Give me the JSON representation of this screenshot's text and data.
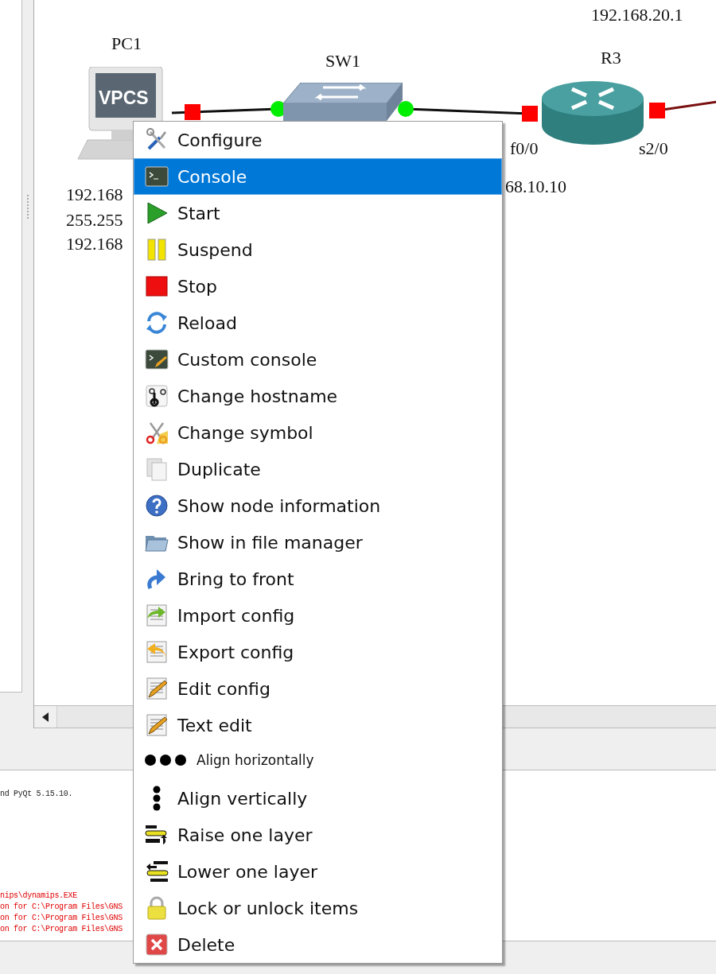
{
  "canvas": {
    "nodes": [
      {
        "kind": "pc",
        "name": "PC1",
        "screen_label": "VPCS"
      },
      {
        "kind": "switch",
        "name": "SW1"
      },
      {
        "kind": "router",
        "name": "R3"
      }
    ],
    "ports": [
      {
        "color": "#ff0000"
      },
      {
        "color": "#00ee00"
      },
      {
        "color": "#00ee00"
      },
      {
        "color": "#ff0000"
      },
      {
        "color": "#ff0000"
      }
    ],
    "labels": [
      {
        "text": "192.168.20.1"
      },
      {
        "text": "192.168"
      },
      {
        "text": "255.255"
      },
      {
        "text": "192.168"
      },
      {
        "text": "68.10.10"
      },
      {
        "text": "f0/0"
      },
      {
        "text": "s2/0"
      }
    ]
  },
  "console": {
    "lines": [
      {
        "text": "nd PyQt 5.15.10.",
        "kind": "info"
      },
      {
        "text": "nips\\dynamips.EXE",
        "kind": "error"
      },
      {
        "text": "on for C:\\Program Files\\GNS",
        "kind": "error"
      },
      {
        "text": "on for C:\\Program Files\\GNS",
        "kind": "error"
      },
      {
        "text": "on for C:\\Program Files\\GNS",
        "kind": "error"
      }
    ]
  },
  "context_menu": {
    "items": [
      {
        "label": "Configure",
        "selected": false,
        "kind": "normal"
      },
      {
        "label": "Console",
        "selected": true,
        "kind": "normal"
      },
      {
        "label": "Start",
        "selected": false,
        "kind": "normal"
      },
      {
        "label": "Suspend",
        "selected": false,
        "kind": "normal"
      },
      {
        "label": "Stop",
        "selected": false,
        "kind": "normal"
      },
      {
        "label": "Reload",
        "selected": false,
        "kind": "normal"
      },
      {
        "label": "Custom console",
        "selected": false,
        "kind": "normal"
      },
      {
        "label": "Change hostname",
        "selected": false,
        "kind": "normal"
      },
      {
        "label": "Change symbol",
        "selected": false,
        "kind": "normal"
      },
      {
        "label": "Duplicate",
        "selected": false,
        "kind": "normal"
      },
      {
        "label": "Show node information",
        "selected": false,
        "kind": "normal"
      },
      {
        "label": "Show in file manager",
        "selected": false,
        "kind": "normal"
      },
      {
        "label": "Bring to front",
        "selected": false,
        "kind": "normal"
      },
      {
        "label": "Import config",
        "selected": false,
        "kind": "normal"
      },
      {
        "label": "Export config",
        "selected": false,
        "kind": "normal"
      },
      {
        "label": "Edit config",
        "selected": false,
        "kind": "normal"
      },
      {
        "label": "Text edit",
        "selected": false,
        "kind": "normal"
      },
      {
        "label": "Align horizontally",
        "selected": false,
        "kind": "compact"
      },
      {
        "label": "Align vertically",
        "selected": false,
        "kind": "normal"
      },
      {
        "label": "Raise one layer",
        "selected": false,
        "kind": "normal"
      },
      {
        "label": "Lower one layer",
        "selected": false,
        "kind": "normal"
      },
      {
        "label": "Lock or unlock items",
        "selected": false,
        "kind": "normal"
      },
      {
        "label": "Delete",
        "selected": false,
        "kind": "normal"
      }
    ]
  }
}
